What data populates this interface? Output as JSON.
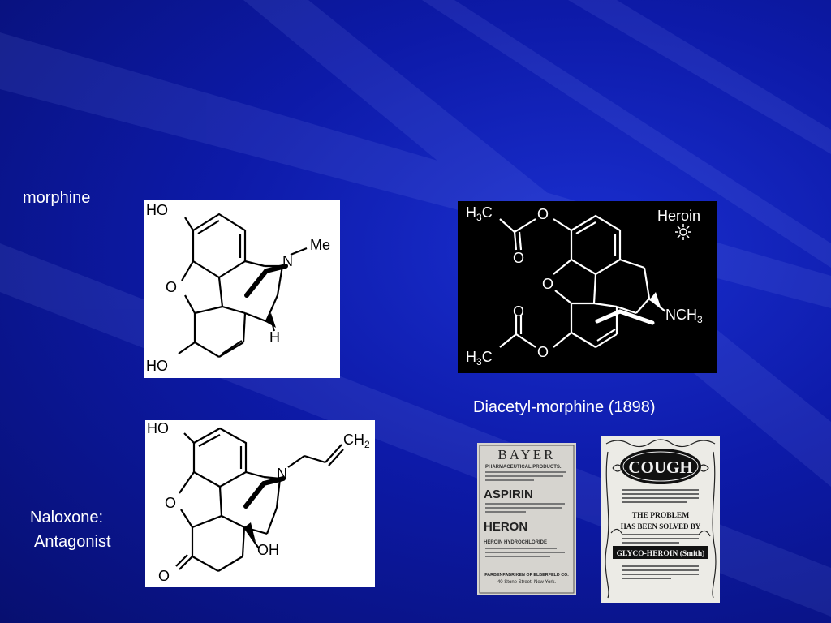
{
  "slide": {
    "labels": {
      "morphine": "morphine",
      "diacetyl": "Diacetyl-morphine (1898)",
      "naloxone_line1": "Naloxone:",
      "naloxone_line2": "Antagonist"
    },
    "colors": {
      "background": "#0d1aa8",
      "rule": "#6a5a6a",
      "text": "#ffffff"
    }
  },
  "morphine_structure": {
    "atoms": {
      "ho_top": "HO",
      "o_ring": "O",
      "ho_bottom": "HO",
      "n": "N",
      "me": "Me",
      "h": "H"
    }
  },
  "heroin_structure": {
    "atoms": {
      "h3c_top": "H",
      "c_top": "C",
      "o_ester_top": "O",
      "o_carbonyl_top": "O",
      "o_ring": "O",
      "o_carbonyl_bottom": "O",
      "h3c_bottom": "H",
      "c_bottom": "C",
      "o_ester_bottom": "O",
      "nch3": "NCH",
      "heroin": "Heroin",
      "sub3": "3"
    }
  },
  "naloxone_structure": {
    "atoms": {
      "ho": "HO",
      "o_ring": "O",
      "n": "N",
      "ch2": "CH",
      "sub2": "2",
      "oh": "OH",
      "o_ketone": "O"
    }
  },
  "bayer_ad": {
    "brand": "BAYER",
    "subtitle": "PHARMACEUTICAL PRODUCTS.",
    "aspirin": "ASPIRIN",
    "heroin": "HERON",
    "heroin_sub": "HEROIN HYDROCHLORIDE",
    "company": "FARBENFABRIKEN OF ELBERFELD CO.",
    "address": "40 Stone Street, New York."
  },
  "cough_ad": {
    "title": "COUGH",
    "line1": "THE PROBLEM",
    "line2": "HAS BEEN SOLVED BY",
    "product": "GLYCO-HEROIN (Smith)"
  }
}
